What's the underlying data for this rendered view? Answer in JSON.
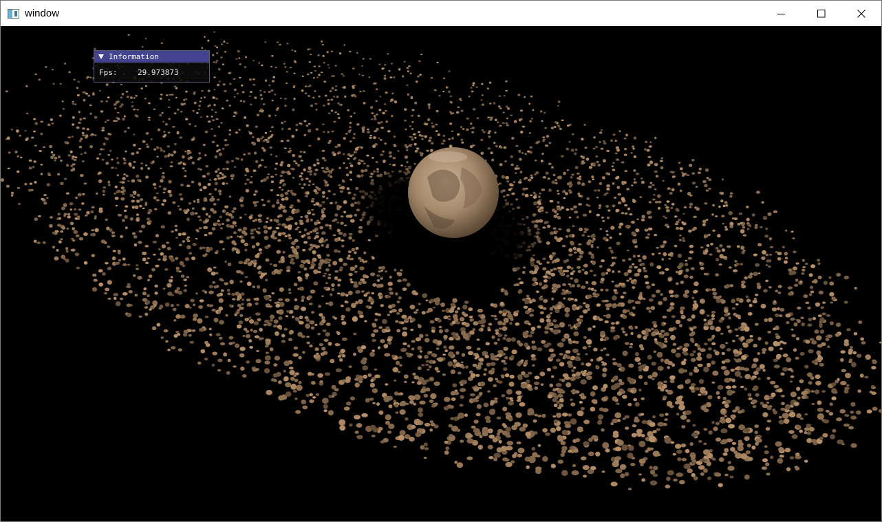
{
  "window": {
    "title": "window",
    "controls": {
      "minimize_icon": "minimize-icon",
      "maximize_icon": "maximize-icon",
      "close_icon": "close-icon"
    }
  },
  "scene": {
    "description_colors": {
      "background": "#000000",
      "asteroid": "#b08a64",
      "planet": "#a58a6c"
    }
  },
  "info_panel": {
    "title": "Information",
    "fps_label": "Fps:",
    "fps_value": "29.973873"
  }
}
